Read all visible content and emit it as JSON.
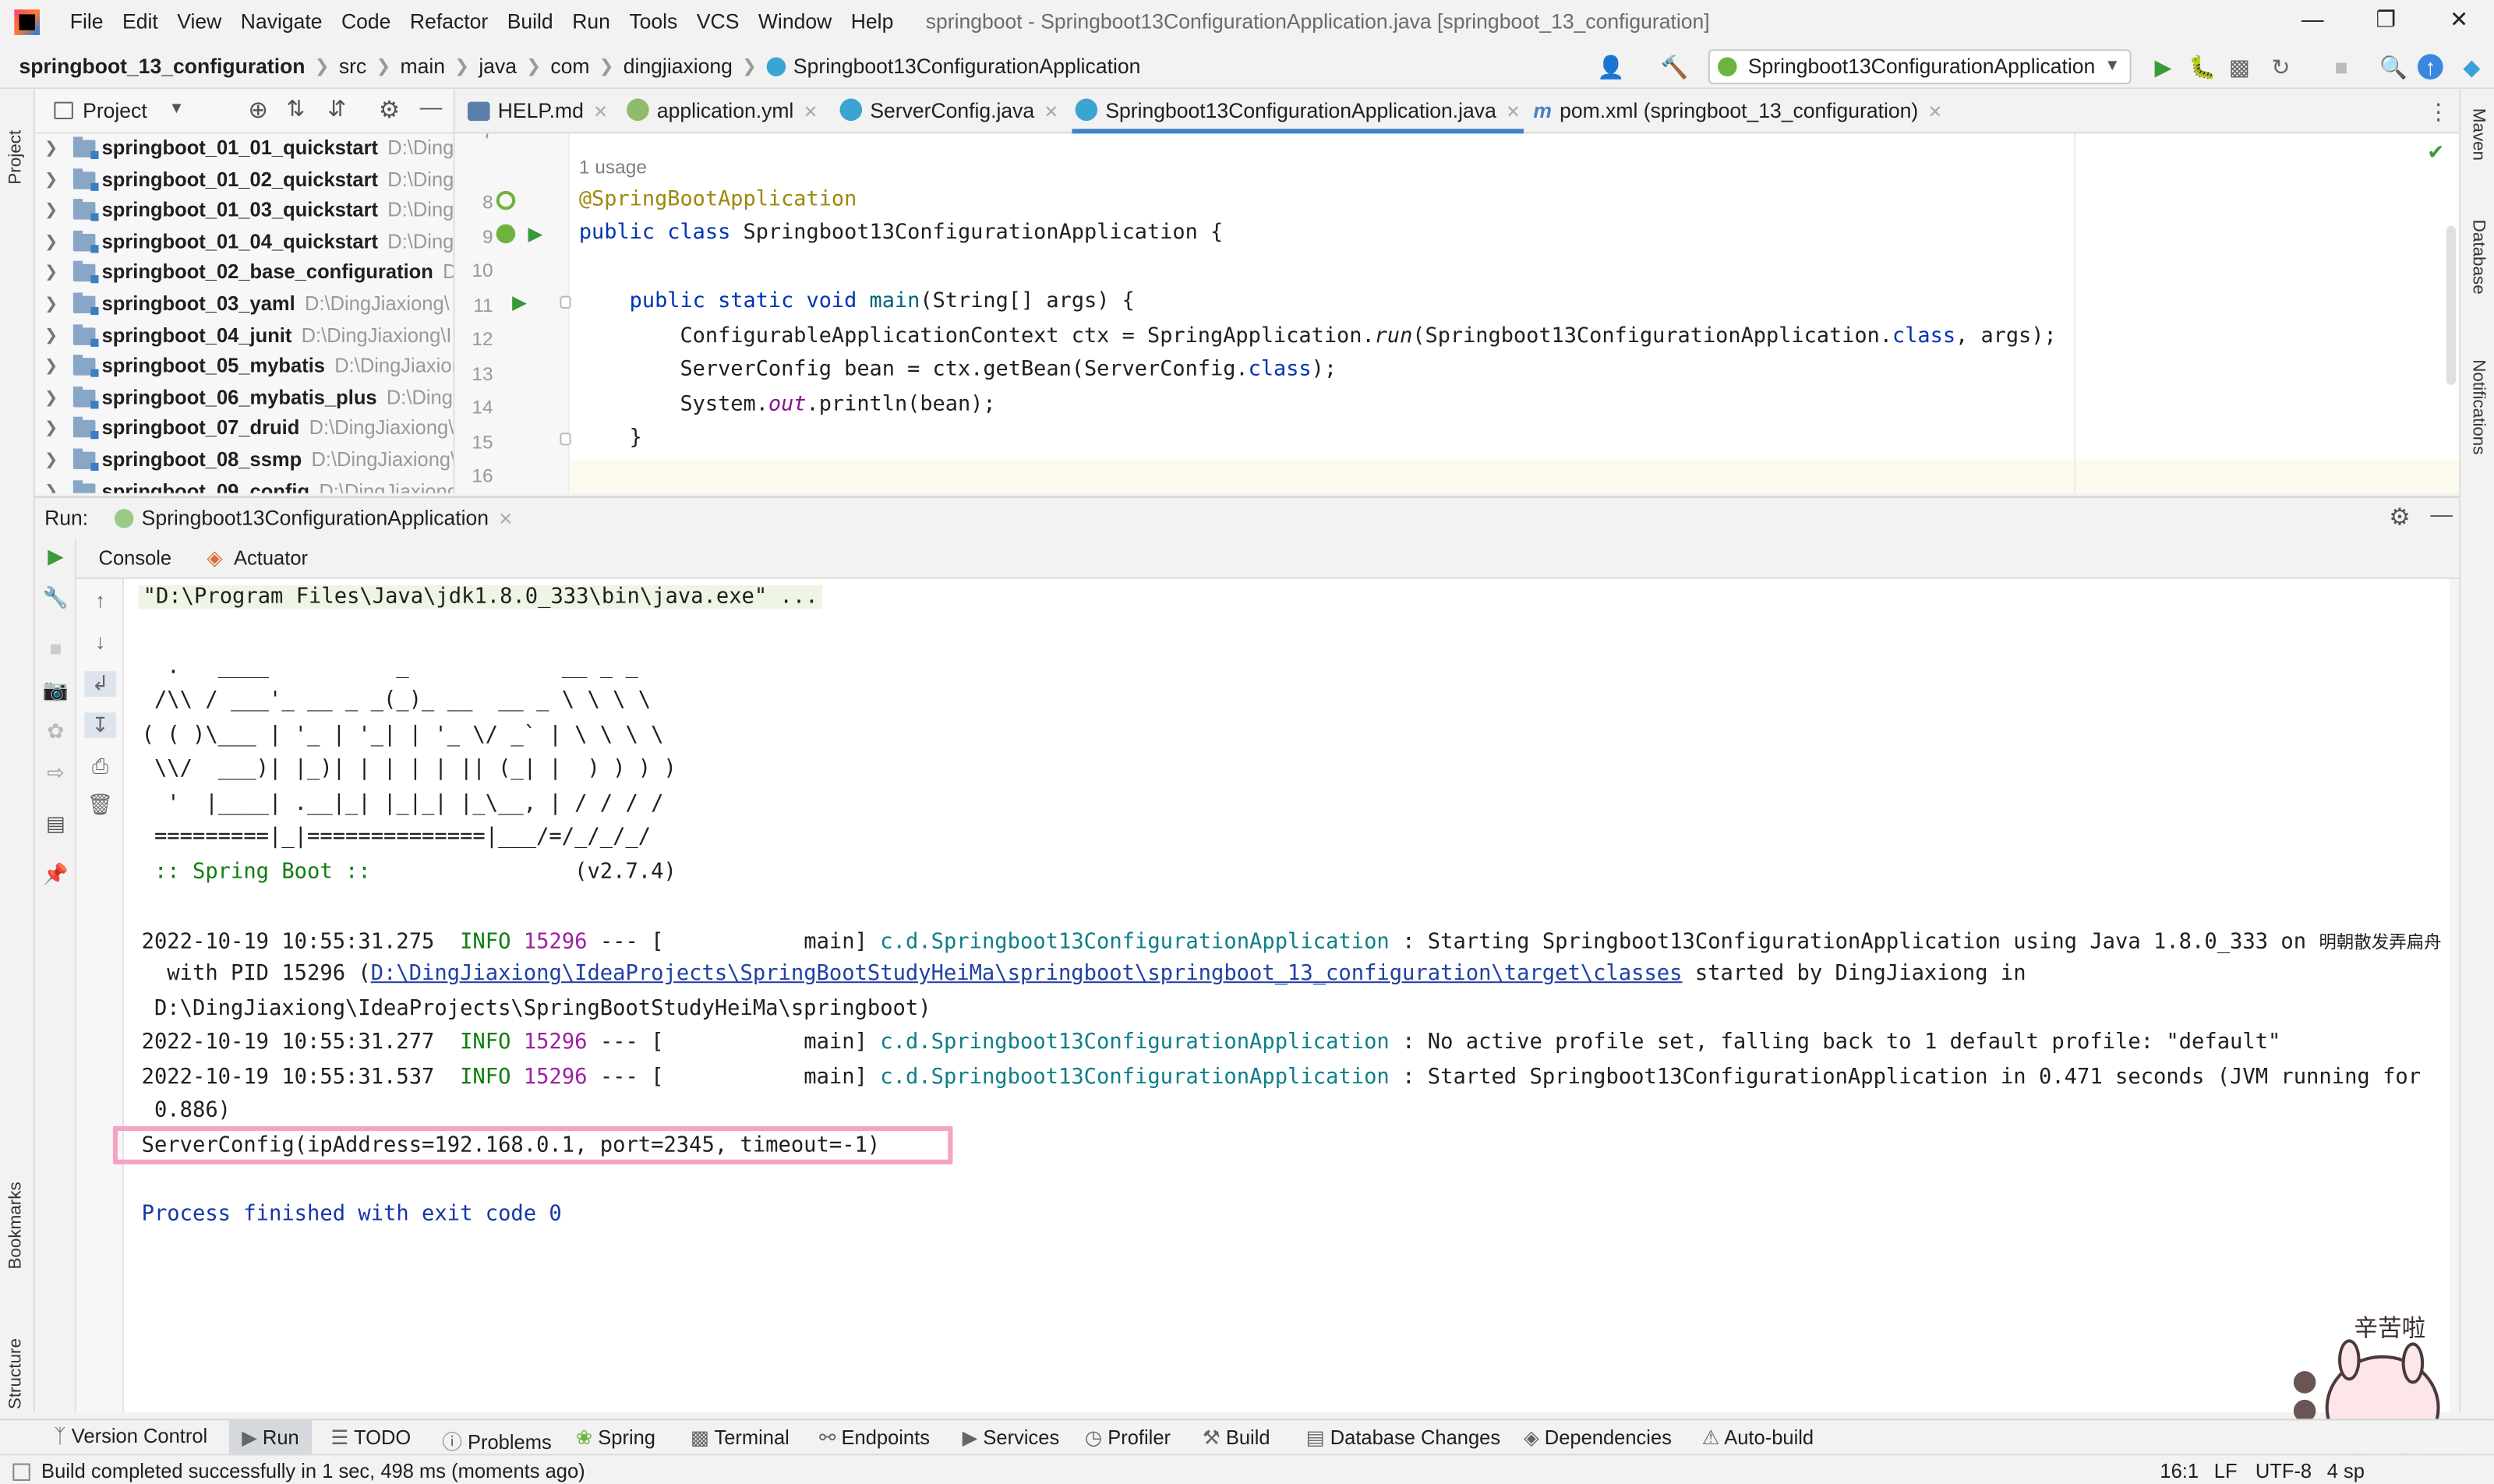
{
  "menu": [
    "File",
    "Edit",
    "View",
    "Navigate",
    "Code",
    "Refactor",
    "Build",
    "Run",
    "Tools",
    "VCS",
    "Window",
    "Help"
  ],
  "window_title": "springboot - Springboot13ConfigurationApplication.java [springboot_13_configuration]",
  "breadcrumbs": {
    "project": "springboot_13_configuration",
    "parts": [
      "src",
      "main",
      "java",
      "com",
      "dingjiaxiong"
    ],
    "class": "Springboot13ConfigurationApplication"
  },
  "run_config": "Springboot13ConfigurationApplication",
  "project_panel": {
    "title": "Project",
    "items": [
      {
        "name": "springboot_01_01_quickstart",
        "path": "D:\\Ding..."
      },
      {
        "name": "springboot_01_02_quickstart",
        "path": "D:\\Ding..."
      },
      {
        "name": "springboot_01_03_quickstart",
        "path": "D:\\Ding..."
      },
      {
        "name": "springboot_01_04_quickstart",
        "path": "D:\\Ding..."
      },
      {
        "name": "springboot_02_base_configuration",
        "path": "D"
      },
      {
        "name": "springboot_03_yaml",
        "path": "D:\\DingJiaxiong\\"
      },
      {
        "name": "springboot_04_junit",
        "path": "D:\\DingJiaxiong\\I"
      },
      {
        "name": "springboot_05_mybatis",
        "path": "D:\\DingJiaxior"
      },
      {
        "name": "springboot_06_mybatis_plus",
        "path": "D:\\DingJ"
      },
      {
        "name": "springboot_07_druid",
        "path": "D:\\DingJiaxiong\\"
      },
      {
        "name": "springboot_08_ssmp",
        "path": "D:\\DingJiaxiong\\"
      },
      {
        "name": "springboot_09_config",
        "path": "D:\\DingJiaxiong"
      }
    ]
  },
  "editor_tabs": [
    "HELP.md",
    "application.yml",
    "ServerConfig.java",
    "Springboot13ConfigurationApplication.java",
    "pom.xml (springboot_13_configuration)"
  ],
  "editor": {
    "usage_hint": "1 usage",
    "line_numbers": [
      "7",
      "8",
      "9",
      "10",
      "11",
      "12",
      "13",
      "14",
      "15",
      "16"
    ],
    "lines": {
      "l8": "@SpringBootApplication",
      "l9a": "public class ",
      "l9b": "Springboot13ConfigurationApplication {",
      "l11a": "    public static void ",
      "l11b": "main",
      "l11c": "(String[] args) {",
      "l12a": "        ConfigurableApplicationContext ctx = SpringApplication.",
      "l12b": "run",
      "l12c": "(Springboot13ConfigurationApplication.",
      "l12d": "class",
      "l12e": ", args);",
      "l13a": "        ServerConfig bean = ctx.getBean(ServerConfig.",
      "l13b": "class",
      "l13c": ");",
      "l14a": "        System.",
      "l14b": "out",
      "l14c": ".println(bean);",
      "l15": "    }"
    }
  },
  "run_panel": {
    "label": "Run:",
    "tab": "Springboot13ConfigurationApplication",
    "console_tabs": [
      "Console",
      "Actuator"
    ]
  },
  "console": {
    "cmd": "\"D:\\Program Files\\Java\\jdk1.8.0_333\\bin\\java.exe\" ...",
    "banner": [
      "  .   ____          _            __ _ _",
      " /\\\\ / ___'_ __ _ _(_)_ __  __ _ \\ \\ \\ \\",
      "( ( )\\___ | '_ | '_| | '_ \\/ _` | \\ \\ \\ \\",
      " \\\\/  ___)| |_)| | | | | || (_| |  ) ) ) )",
      "  '  |____| .__|_| |_|_| |_\\__, | / / / /",
      " =========|_|==============|___/=/_/_/_/"
    ],
    "spring_boot_label": " :: Spring Boot :: ",
    "spring_boot_version": "               (v2.7.4)",
    "log1": {
      "ts": "2022-10-19 10:55:31.275",
      "level": "INFO",
      "pid": "15296",
      "sep": " --- [           main] ",
      "logger": "c.d.Springboot13ConfigurationApplication",
      "msg": " : Starting Springboot13ConfigurationApplication using Java 1.8.0_333 on ",
      "host": "明朝散发弄扁舟"
    },
    "log1_line2a": "  with PID 15296 (",
    "log1_link": "D:\\DingJiaxiong\\IdeaProjects\\SpringBootStudyHeiMa\\springboot\\springboot_13_configuration\\target\\classes",
    "log1_line2b": " started by DingJiaxiong in",
    "log1_line3": " D:\\DingJiaxiong\\IdeaProjects\\SpringBootStudyHeiMa\\springboot)",
    "log2": {
      "ts": "2022-10-19 10:55:31.277",
      "level": "INFO",
      "pid": "15296",
      "sep": " --- [           main] ",
      "logger": "c.d.Springboot13ConfigurationApplication",
      "msg": " : No active profile set, falling back to 1 default profile: \"default\""
    },
    "log3": {
      "ts": "2022-10-19 10:55:31.537",
      "level": "INFO",
      "pid": "15296",
      "sep": " --- [           main] ",
      "logger": "c.d.Springboot13ConfigurationApplication",
      "msg": " : Started Springboot13ConfigurationApplication in 0.471 seconds (JVM running for"
    },
    "log3_cont": " 0.886)",
    "output": "ServerConfig(ipAddress=192.168.0.1, port=2345, timeout=-1)",
    "exit": "Process finished with exit code 0"
  },
  "bottom_tools": [
    "Version Control",
    "Run",
    "TODO",
    "Problems",
    "Spring",
    "Terminal",
    "Endpoints",
    "Services",
    "Profiler",
    "Build",
    "Database Changes",
    "Dependencies",
    "Auto-build"
  ],
  "status": {
    "message": "Build completed successfully in 1 sec, 498 ms (moments ago)",
    "position": "16:1",
    "line_sep": "LF",
    "encoding": "UTF-8",
    "indent": "4 sp"
  },
  "side_tools": {
    "project": "Project",
    "bookmarks": "Bookmarks",
    "structure": "Structure",
    "maven": "Maven",
    "database": "Database",
    "notifications": "Notifications"
  },
  "sticker_text": "辛苦啦",
  "colors": {
    "accent": "#4083c9",
    "highlight_box": "#f4a3c5",
    "keyword": "#0033b3",
    "annotation": "#9e880d"
  }
}
